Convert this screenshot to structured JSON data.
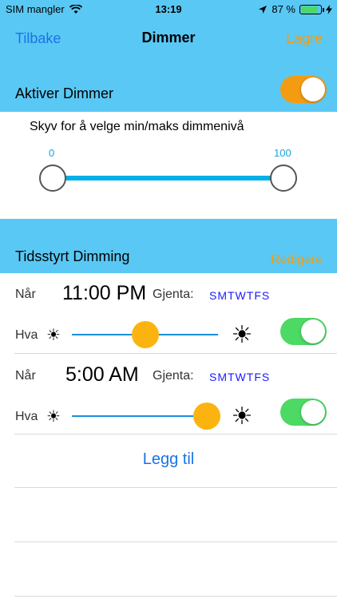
{
  "status_bar": {
    "carrier": "SIM mangler",
    "time": "13:19",
    "battery": "87 %",
    "battery_level": 0.87,
    "icons": [
      "wifi-icon",
      "location-arrow-icon",
      "battery-icon",
      "charging-bolt-icon"
    ]
  },
  "nav": {
    "back_label": "Tilbake",
    "title": "Dimmer",
    "save_label": "Lagre"
  },
  "dimmer": {
    "enable_label": "Aktiver Dimmer",
    "enabled": true,
    "range_title": "Skyv for å velge min/maks dimmenivå",
    "min_label": "0",
    "max_label": "100",
    "min_value": 0,
    "max_value": 100
  },
  "scheduled": {
    "title": "Tidsstyrt Dimming",
    "edit_label": "Redigere",
    "entries": [
      {
        "when_label": "Når",
        "time": "11:00 PM",
        "repeat_label": "Gjenta:",
        "days": "SMTWTFS",
        "what_label": "Hva",
        "level": 0.5,
        "enabled": true
      },
      {
        "when_label": "Når",
        "time": "5:00 AM",
        "repeat_label": "Gjenta:",
        "days": "SMTWTFS",
        "what_label": "Hva",
        "level": 0.92,
        "enabled": true
      }
    ],
    "add_label": "Legg til"
  },
  "colors": {
    "header_blue": "#5ac8f4",
    "accent_orange": "#f39c12",
    "link_blue": "#1a73e8",
    "toggle_green": "#4cd964",
    "slider_thumb": "#fbb40f"
  }
}
